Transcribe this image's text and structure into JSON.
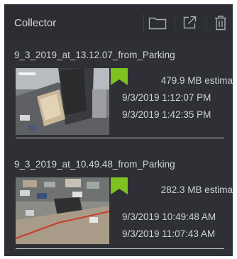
{
  "panel": {
    "title": "Collector"
  },
  "toolbar": {
    "buttons": [
      {
        "icon": "folder-icon"
      },
      {
        "icon": "export-icon"
      },
      {
        "icon": "trash-icon"
      }
    ]
  },
  "recordings": [
    {
      "name": "9_3_2019_at_13.12.07_from_Parking",
      "size": "479.9 MB estima",
      "start": "9/3/2019 1:12:07 PM",
      "end": "9/3/2019 1:42:35 PM",
      "flag_color": "#7dc221",
      "thumbnail_icon": "video-thumbnail-icon"
    },
    {
      "name": "9_3_2019_at_10.49.48_from_Parking",
      "size": "282.3 MB estima",
      "start": "9/3/2019 10:49:48 AM",
      "end": "9/3/2019 11:07:43 AM",
      "flag_color": "#7dc221",
      "thumbnail_icon": "video-thumbnail-icon"
    }
  ],
  "colors": {
    "panel_bg": "#2e3035",
    "text": "#cfd2d6",
    "accent_flag": "#7dc221"
  }
}
